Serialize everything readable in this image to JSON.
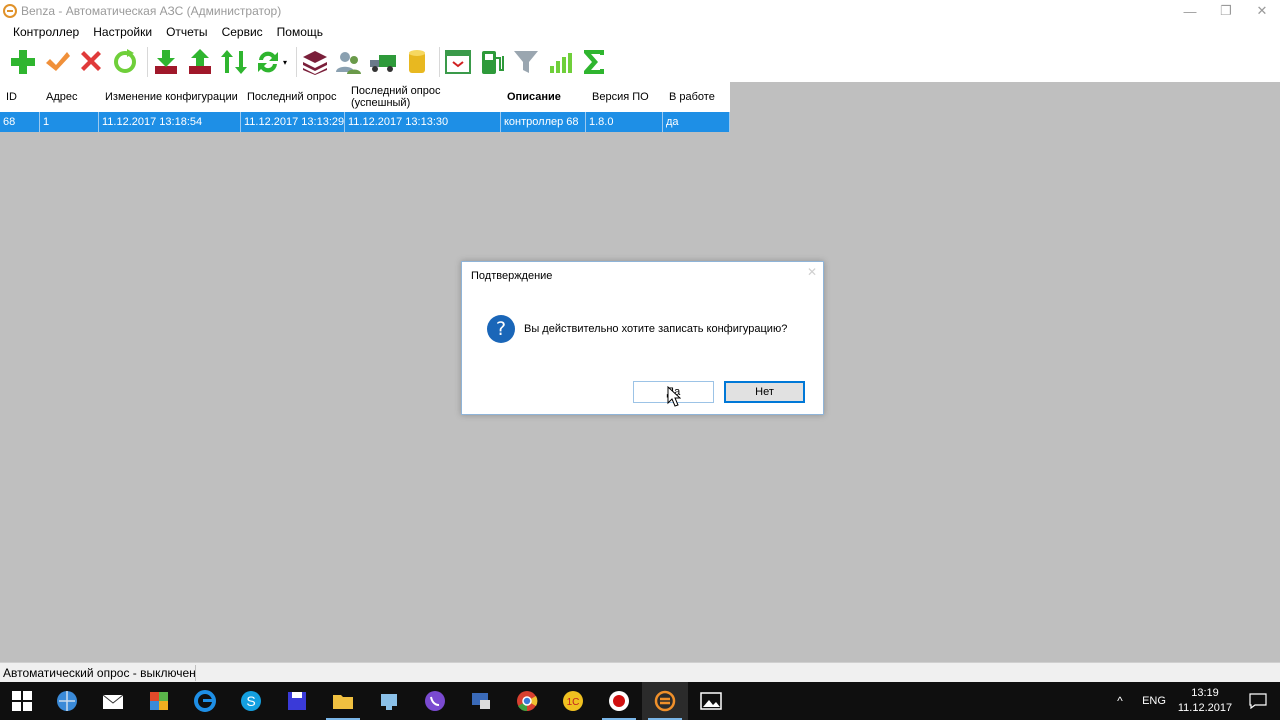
{
  "window": {
    "title": "Benza - Автоматическая АЗС (Администратор)",
    "minimize": "—",
    "restore": "❐",
    "close": "✕"
  },
  "menu": {
    "items": [
      "Контроллер",
      "Настройки",
      "Отчеты",
      "Сервис",
      "Помощь"
    ]
  },
  "toolbar": {
    "icons": [
      "add-icon",
      "check-icon",
      "delete-icon",
      "refresh-icon",
      "download-icon",
      "upload-icon",
      "sync-arrows-icon",
      "cycle-icon",
      "layers-icon",
      "users-icon",
      "truck-icon",
      "tank-icon",
      "calendar-icon",
      "fuel-pump-icon",
      "filter-icon",
      "signal-icon",
      "sum-icon"
    ],
    "dropdown_glyph": "▾"
  },
  "grid": {
    "headers": {
      "id": "ID",
      "address": "Адрес",
      "config_change": "Изменение конфигурации",
      "last_poll": "Последний опрос",
      "last_poll_ok": "Последний опрос (успешный)",
      "description": "Описание",
      "version": "Версия ПО",
      "in_work": "В работе"
    },
    "rows": [
      {
        "id": "68",
        "address": "1",
        "config_change": "11.12.2017 13:18:54",
        "last_poll": "11.12.2017 13:13:29",
        "last_poll_ok": "11.12.2017 13:13:30",
        "description": "контроллер 68",
        "version": "1.8.0",
        "in_work": "да"
      }
    ]
  },
  "dialog": {
    "title": "Подтверждение",
    "message": "Вы действительно хотите записать конфигурацию?",
    "icon_glyph": "?",
    "yes_label": "Да",
    "no_label": "Нет",
    "close": "✕"
  },
  "statusbar": {
    "text": "Автоматический опрос - выключен"
  },
  "taskbar": {
    "tray_chevron": "^",
    "language": "ENG",
    "time": "13:19",
    "date": "11.12.2017"
  },
  "colors": {
    "selection": "#1e8fe6",
    "dialog_border": "#8fb4d8",
    "accent": "#0078d7"
  }
}
